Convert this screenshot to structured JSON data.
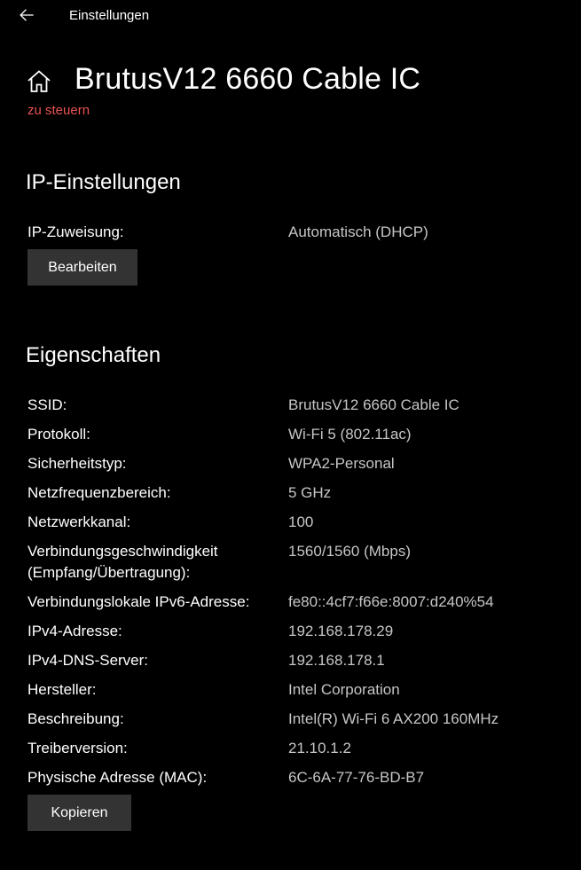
{
  "window": {
    "title": "Einstellungen"
  },
  "header": {
    "title": "BrutusV12 6660 Cable IC",
    "subtitle": "zu steuern",
    "subtitle_color": "#e8534f"
  },
  "ip_settings": {
    "heading": "IP-Einstellungen",
    "assignment_label": "IP-Zuweisung:",
    "assignment_value": "Automatisch (DHCP)",
    "edit_button": "Bearbeiten"
  },
  "properties": {
    "heading": "Eigenschaften",
    "rows": [
      {
        "label": "SSID:",
        "value": "BrutusV12 6660 Cable IC"
      },
      {
        "label": "Protokoll:",
        "value": "Wi-Fi 5 (802.11ac)"
      },
      {
        "label": "Sicherheitstyp:",
        "value": "WPA2-Personal"
      },
      {
        "label": "Netzfrequenzbereich:",
        "value": "5 GHz"
      },
      {
        "label": "Netzwerkkanal:",
        "value": "100"
      },
      {
        "label": "Verbindungsgeschwindigkeit",
        "label2": "(Empfang/Übertragung):",
        "value": "1560/1560 (Mbps)"
      },
      {
        "label": "Verbindungslokale IPv6-Adresse:",
        "value": "fe80::4cf7:f66e:8007:d240%54"
      },
      {
        "label": "IPv4-Adresse:",
        "value": "192.168.178.29"
      },
      {
        "label": "IPv4-DNS-Server:",
        "value": "192.168.178.1"
      },
      {
        "label": "Hersteller:",
        "value": "Intel Corporation"
      },
      {
        "label": "Beschreibung:",
        "value": "Intel(R) Wi-Fi 6 AX200 160MHz"
      },
      {
        "label": "Treiberversion:",
        "value": "21.10.1.2"
      },
      {
        "label": "Physische Adresse (MAC):",
        "value": "6C-6A-77-76-BD-B7"
      }
    ],
    "copy_button": "Kopieren"
  }
}
